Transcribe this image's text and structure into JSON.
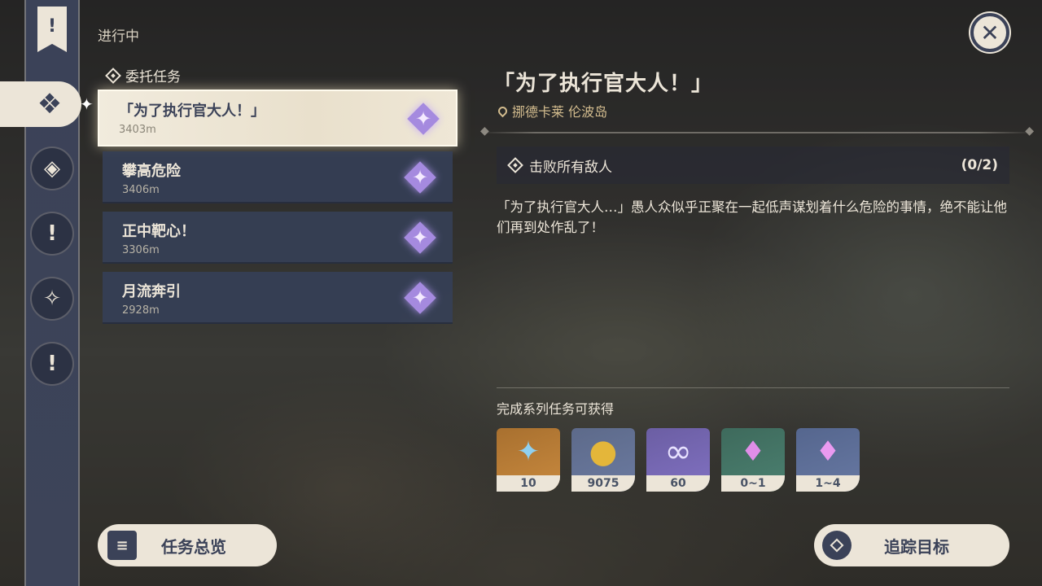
{
  "sidebar": {
    "banner_icon": "exclamation-banner-icon",
    "items": [
      {
        "name": "all-quests",
        "icon": "four-diamonds-icon",
        "active": true
      },
      {
        "name": "archon-quests",
        "icon": "diamond-exclaim-icon"
      },
      {
        "name": "story-quests",
        "icon": "exclaim-icon"
      },
      {
        "name": "world-quests",
        "icon": "star-diamond-icon"
      },
      {
        "name": "daily-quests",
        "icon": "exclaim-plain-icon"
      }
    ]
  },
  "section_title": "进行中",
  "group_title": "委托任务",
  "quests": [
    {
      "name": "「为了执行官大人！」",
      "distance": "3403m",
      "selected": true
    },
    {
      "name": "攀高危险",
      "distance": "3406m"
    },
    {
      "name": "正中靶心！",
      "distance": "3306m"
    },
    {
      "name": "月流奔引",
      "distance": "2928m"
    }
  ],
  "detail": {
    "title": "「为了执行官大人！」",
    "location": "挪德卡莱 伦波岛",
    "objective": {
      "text": "击败所有敌人",
      "count": "(0/2)"
    },
    "description": "「为了执行官大人…」愚人众似乎正聚在一起低声谋划着什么危险的事情，绝不能让他们再到处作乱了！",
    "rewards_label": "完成系列任务可获得",
    "rewards": [
      {
        "name": "primogem",
        "amount": "10",
        "glyph": "✦",
        "color": "#8fd0f0"
      },
      {
        "name": "mora",
        "amount": "9075",
        "glyph": "●",
        "color": "#e4b63a"
      },
      {
        "name": "adventure-exp",
        "amount": "60",
        "glyph": "∞",
        "color": "#d9d0ff"
      },
      {
        "name": "crystal-ore",
        "amount": "0~1",
        "glyph": "♦",
        "color": "#d98be0"
      },
      {
        "name": "crystal-cluster",
        "amount": "1~4",
        "glyph": "♦",
        "color": "#e08ee8"
      }
    ]
  },
  "buttons": {
    "overview": "任务总览",
    "track": "追踪目标",
    "close_glyph": "✕"
  }
}
